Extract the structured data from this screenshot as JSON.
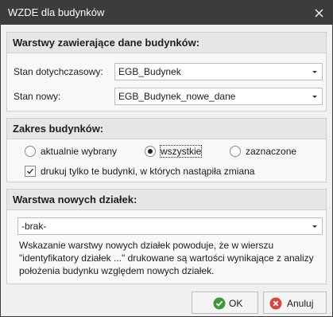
{
  "window": {
    "title": "WZDE dla budynków"
  },
  "buildings_layers": {
    "header": "Warstwy zawierające dane budynków:",
    "current_label": "Stan dotychczasowy:",
    "current_value": "EGB_Budynek",
    "new_label": "Stan nowy:",
    "new_value": "EGB_Budynek_nowe_dane"
  },
  "scope": {
    "header": "Zakres budynków:",
    "options": [
      "aktualnie wybrany",
      "wszystkie",
      "zaznaczone"
    ],
    "selected": "wszystkie",
    "checkbox_label": "drukuj tylko te budynki, w których nastąpiła zmiana",
    "checkbox_checked": true
  },
  "parcels_layer": {
    "header": "Warstwa nowych działek:",
    "value": "-brak-",
    "note": "Wskazanie warstwy nowych działek powoduje, że w wierszu \"identyfikatory działek ...\" drukowane są wartości wynikające z analizy położenia budynku względem nowych działek."
  },
  "buttons": {
    "ok": "OK",
    "cancel": "Anuluj"
  },
  "colors": {
    "titlebar": "#3c3c3c",
    "ok_icon": "#3a9a3a",
    "cancel_icon": "#d9453f"
  },
  "icons": {
    "close": "close-icon",
    "ok": "check-circle-icon",
    "cancel": "x-circle-icon"
  }
}
